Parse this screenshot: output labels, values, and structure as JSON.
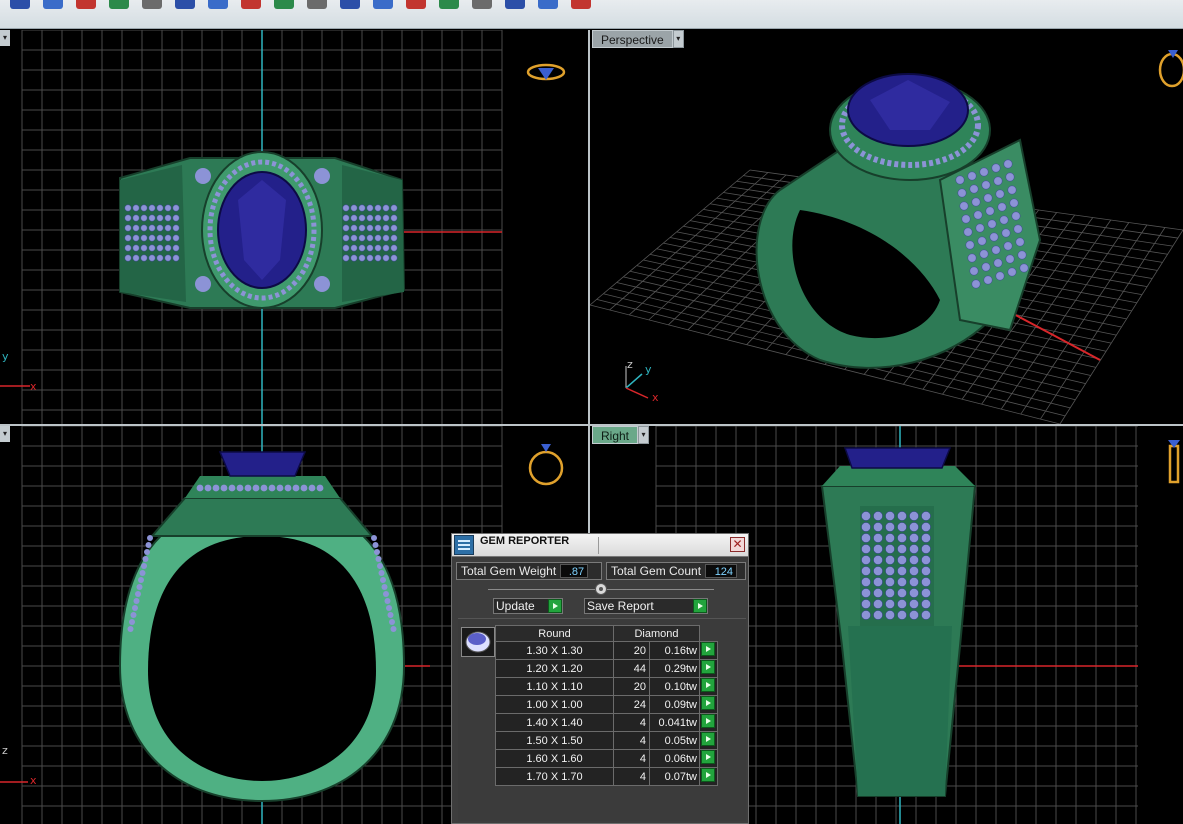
{
  "toolbar": {
    "icons": [
      "view-icon",
      "move-icon",
      "scale-icon",
      "rotate-icon",
      "arrow-icon",
      "curve-icon",
      "pen-icon",
      "grid-icon",
      "snap-icon",
      "line-icon",
      "measure-icon",
      "box-icon",
      "text-icon",
      "gem-icon",
      "prong-icon",
      "bezel-icon",
      "pave-icon",
      "render-icon"
    ]
  },
  "viewports": {
    "top_left": {
      "label": "",
      "axis_x": "x",
      "axis_y": "y"
    },
    "top_right": {
      "label": "Perspective",
      "axis_x": "x",
      "axis_y": "y",
      "axis_z": "z"
    },
    "bottom_left": {
      "label": "",
      "axis_x": "x",
      "axis_z": "z"
    },
    "bottom_right": {
      "label": "Right"
    }
  },
  "gem_reporter": {
    "title": "GEM REPORTER",
    "total_gem_weight_label": "Total Gem Weight",
    "total_gem_weight": ".87",
    "total_gem_count_label": "Total Gem Count",
    "total_gem_count": "124",
    "update_label": "Update",
    "save_report_label": "Save Report",
    "table": {
      "shape_header": "Round",
      "material_header": "Diamond",
      "rows": [
        {
          "size": "1.30 X 1.30",
          "count": "20",
          "weight": "0.16tw"
        },
        {
          "size": "1.20 X 1.20",
          "count": "44",
          "weight": "0.29tw"
        },
        {
          "size": "1.10 X 1.10",
          "count": "20",
          "weight": "0.10tw"
        },
        {
          "size": "1.00 X 1.00",
          "count": "24",
          "weight": "0.09tw"
        },
        {
          "size": "1.40 X 1.40",
          "count": "4",
          "weight": "0.041tw"
        },
        {
          "size": "1.50 X 1.50",
          "count": "4",
          "weight": "0.05tw"
        },
        {
          "size": "1.60 X 1.60",
          "count": "4",
          "weight": "0.06tw"
        },
        {
          "size": "1.70 X 1.70",
          "count": "4",
          "weight": "0.07tw"
        }
      ]
    }
  },
  "colors": {
    "metal": "#2d7a55",
    "metal_light": "#5fb88c",
    "gem_center": "#23208a",
    "pave": "#8c93d6",
    "grid": "#4a4a4a",
    "axis_red": "#d8262a",
    "axis_cyan": "#2fb5c0",
    "ring_icon": "#e0a12c"
  }
}
